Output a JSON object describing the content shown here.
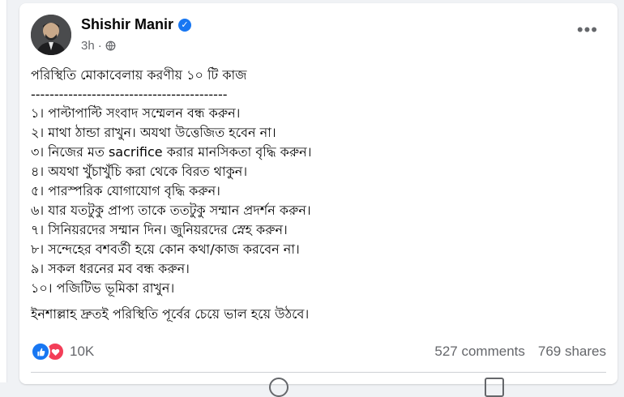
{
  "post": {
    "author": "Shishir Manir",
    "time": "3h",
    "visibility_icon": "globe-icon",
    "verified_icon": "verified-badge-icon",
    "more_icon": "more-options-icon",
    "title": "পরিস্থিতি মোকাবেলায় করণীয় ১০ টি কাজ",
    "separator": "------------------------------------------",
    "items": [
      "১। পাল্টাপাল্টি সংবাদ সম্মেলন বন্ধ করুন।",
      "২। মাথা ঠান্ডা রাখুন। অযথা উত্তেজিত হবেন না।",
      "৩। নিজের মত sacrifice করার মানসিকতা বৃদ্ধি করুন।",
      "৪। অযথা খুঁচাখুঁচি করা থেকে বিরত থাকুন।",
      "৫। পারস্পরিক যোগাযোগ বৃদ্ধি করুন।",
      "৬। যার যতটুকু প্রাপ্য তাকে ততটুকু সম্মান প্রদর্শন করুন।",
      "৭। সিনিয়রদের সম্মান দিন। জুনিয়রদের স্নেহ করুন।",
      "৮। সন্দেহের বশবর্তী হয়ে কোন কথা/কাজ করবেন না।",
      "৯। সকল ধরনের মব বন্ধ করুন।",
      "১০। পজিটিভ ভূমিকা রাখুন।"
    ],
    "closing": "ইনশাল্লাহ দ্রুতই পরিস্থিতি পূর্বের চেয়ে ভাল হয়ে উঠবে।"
  },
  "engagement": {
    "reaction_icons": [
      "like-icon",
      "love-icon"
    ],
    "reaction_count": "10K",
    "comments": "527 comments",
    "shares": "769 shares"
  },
  "colors": {
    "accent": "#1877f2",
    "love": "#f33e58",
    "text": "#050505",
    "secondary_text": "#65676b",
    "background": "#f0f2f5"
  }
}
